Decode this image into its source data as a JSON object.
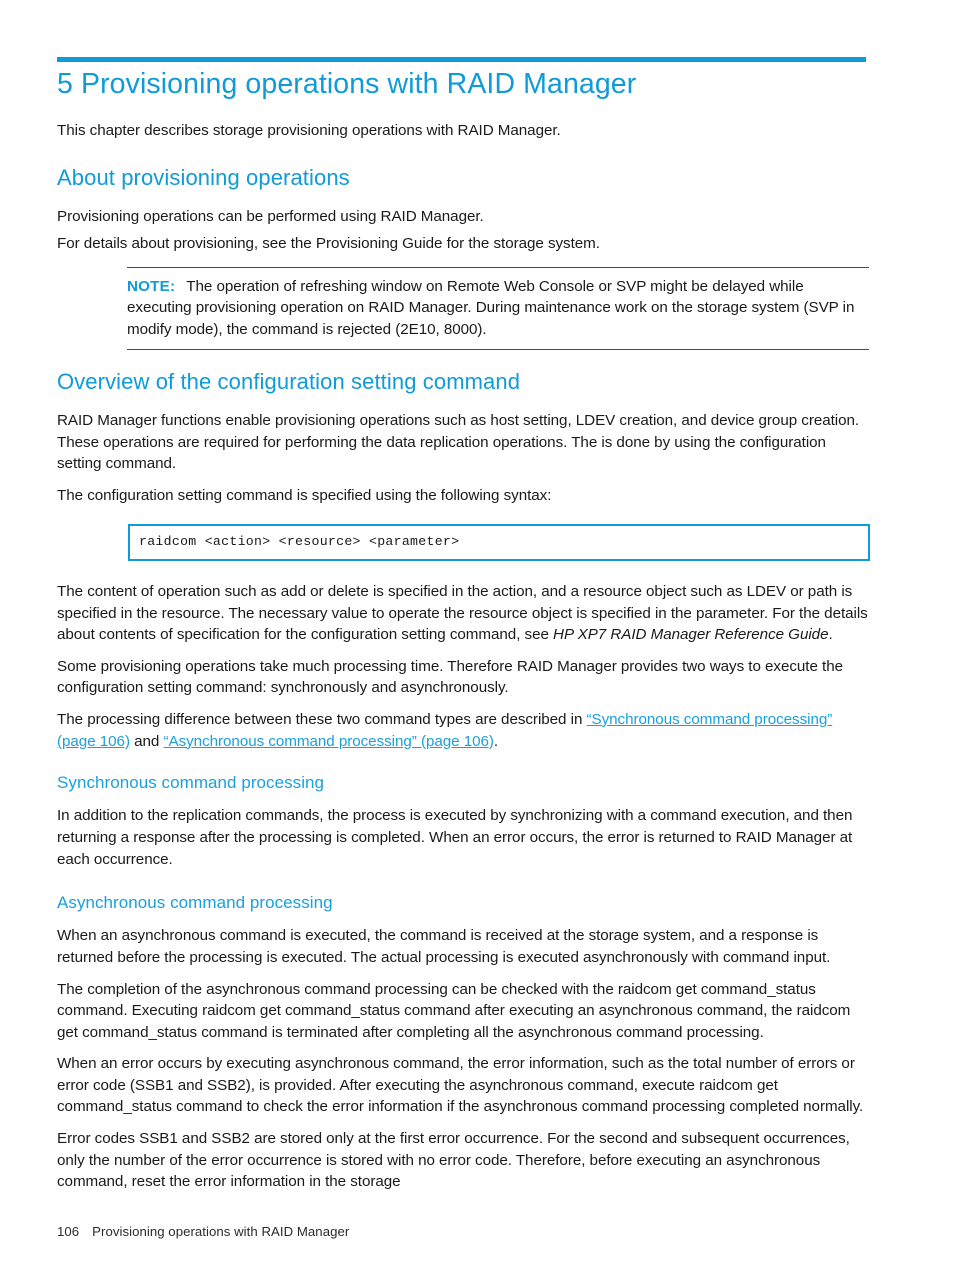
{
  "document": {
    "chapter_number": "5",
    "chapter_title": "5 Provisioning operations with RAID Manager",
    "intro": "This chapter describes storage provisioning operations with RAID Manager."
  },
  "sections": {
    "about": {
      "heading": "About provisioning operations",
      "para1": "Provisioning operations can be performed using RAID Manager.",
      "para2": "For details about provisioning, see the Provisioning Guide for the storage system.",
      "note": {
        "label": "NOTE:",
        "text": "The operation of refreshing window on Remote Web Console or SVP might be delayed while executing provisioning operation on RAID Manager. During maintenance work on the storage system (SVP in modify mode), the command is rejected (2E10, 8000)."
      }
    },
    "overview": {
      "heading": "Overview of the configuration setting command",
      "para1": "RAID Manager functions enable provisioning operations such as host setting, LDEV creation, and device group creation. These operations are required for performing the data replication operations. The is done by using the configuration setting command.",
      "para2": "The configuration setting command is specified using the following syntax:",
      "code": "raidcom <action> <resource> <parameter>",
      "para3_a": "The content of operation such as add or delete is specified in the action, and a resource object such as LDEV or path is specified in the resource. The necessary value to operate the resource object is specified in the parameter. For the details about contents of specification for the configuration setting command, see ",
      "para3_italic": "HP XP7 RAID Manager Reference Guide",
      "para3_b": ".",
      "para4": "Some provisioning operations take much processing time. Therefore RAID Manager provides two ways to execute the configuration setting command: synchronously and asynchronously.",
      "para5_a": "The processing difference between these two command types are described in ",
      "para5_link1": "“Synchronous command processing” (page 106)",
      "para5_mid": " and ",
      "para5_link2": "“Asynchronous command processing” (page 106)",
      "para5_b": "."
    },
    "synchronous": {
      "heading": "Synchronous command processing",
      "para1": "In addition to the replication commands, the process is executed by synchronizing with a command execution, and then returning a response after the processing is completed. When an error occurs, the error is returned to RAID Manager at each occurrence."
    },
    "asynchronous": {
      "heading": "Asynchronous command processing",
      "para1": "When an asynchronous command is executed, the command is received at the storage system, and a response is returned before the processing is executed. The actual processing is executed asynchronously with command input.",
      "para2": "The completion of the asynchronous command processing can be checked with the raidcom get command_status command. Executing raidcom get command_status command after executing an asynchronous command, the raidcom get command_status command is terminated after completing all the asynchronous command processing.",
      "para3": "When an error occurs by executing asynchronous command, the error information, such as the total number of errors or error code (SSB1 and SSB2), is provided. After executing the asynchronous command, execute raidcom get command_status command to check the error information if the asynchronous command processing completed normally.",
      "para4": "Error codes SSB1 and SSB2 are stored only at the first error occurrence. For the second and subsequent occurrences, only the number of the error occurrence is stored with no error code. Therefore, before executing an asynchronous command, reset the error information in the storage"
    }
  },
  "footer": {
    "page_number": "106",
    "running_title": "Provisioning operations with RAID Manager"
  },
  "colors": {
    "accent_blue": "#0f9bd7",
    "link_blue": "#1aa0da",
    "body_text": "#1a1a1a",
    "rule_gray": "#4a4a4a"
  }
}
